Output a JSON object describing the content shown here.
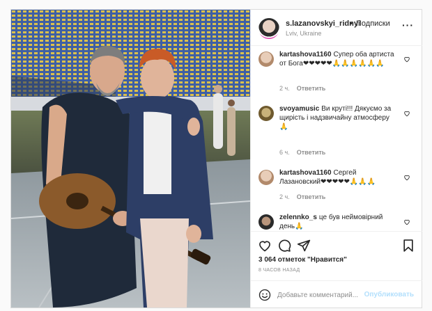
{
  "header": {
    "username": "s.lazanovskyi_ridnyi",
    "separator": "•",
    "follow_label": "Подписки",
    "location": "Lviv, Ukraine",
    "more_icon": "more-horizontal-icon"
  },
  "comments": [
    {
      "username": "kartashova1160",
      "text": "Супер оба артиста от Бога❤❤❤❤❤🙏🙏🙏🙏🙏🙏",
      "time": "2 ч.",
      "reply_label": "Ответить",
      "avatar_color": "#d9c3b0"
    },
    {
      "username": "svoyamusic",
      "text": "Ви круті!!! Дякуємо за щирість і надзвичайну атмосферу🙏",
      "time": "6 ч.",
      "reply_label": "Ответить",
      "avatar_color": "#9c8a5b"
    },
    {
      "username": "kartashova1160",
      "text": "Сергей Лазановский❤❤❤❤❤🙏🙏🙏",
      "time": "2 ч.",
      "reply_label": "Ответить",
      "avatar_color": "#d9c3b0"
    },
    {
      "username": "zelennko_s",
      "text": "це був неймовірний день🙏",
      "time": "",
      "reply_label": "",
      "avatar_color": "#3a3a3a"
    }
  ],
  "actions": {
    "like_icon": "heart-icon",
    "comment_icon": "comment-icon",
    "share_icon": "share-icon",
    "save_icon": "bookmark-icon"
  },
  "likes_text": "3 064 отметок \"Нравится\"",
  "timestamp": "8 ЧАСОВ НАЗАД",
  "add_comment": {
    "placeholder": "Добавьте комментарий...",
    "publish_label": "Опубликовать",
    "emoji_icon": "emoji-icon"
  },
  "colors": {
    "accent": "#0095f6",
    "publish_disabled": "#b2dffc",
    "muted": "#8e8e8e",
    "border": "#dbdbdb"
  }
}
